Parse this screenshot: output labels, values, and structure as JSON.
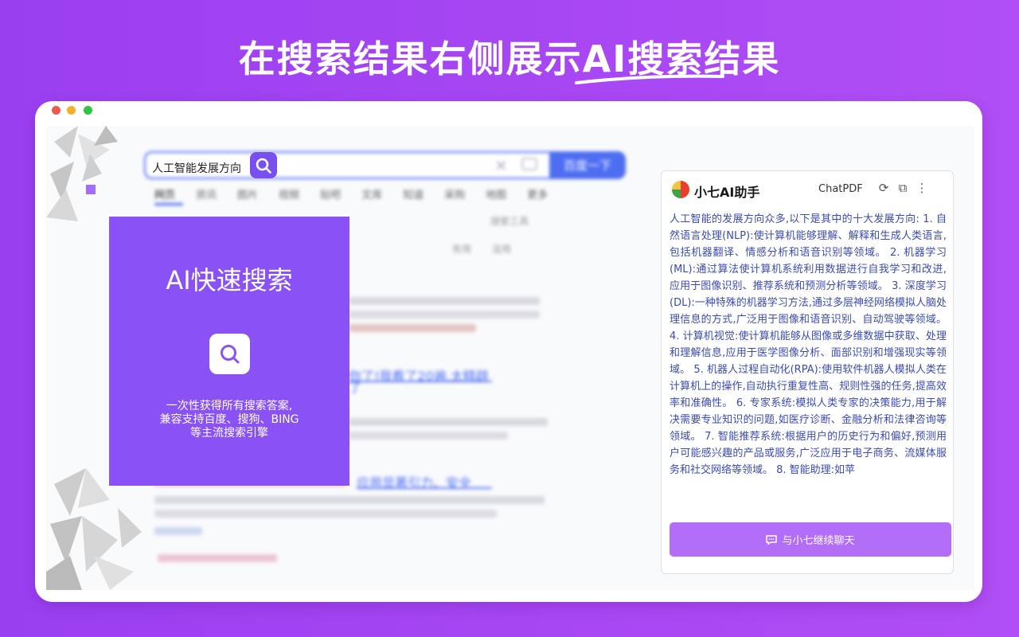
{
  "headline": "在搜索结果右侧展示AI搜索结果",
  "search": {
    "query": "人工智能发展方向",
    "button_label": "百度一下",
    "tabs": [
      "网页",
      "资讯",
      "图片",
      "视频",
      "贴吧",
      "文库",
      "知道",
      "采购",
      "地图",
      "更多"
    ],
    "filter_tool": "搜索工具",
    "feedback": [
      "有用",
      "没用"
    ],
    "result_link_1": "你了!我看了20遍,太精辟了",
    "result_link_2": "应用显著引力、安全"
  },
  "promo": {
    "title": "AI快速搜索",
    "desc_line1": "一次性获得所有搜索答案,",
    "desc_line2": "兼容支持百度、搜狗、BING",
    "desc_line3": "等主流搜索引擎"
  },
  "panel": {
    "title": "小七AI助手",
    "chatpdf": "ChatPDF",
    "body": "人工智能的发展方向众多,以下是其中的十大发展方向: 1. 自然语言处理(NLP):使计算机能够理解、解释和生成人类语言,包括机器翻译、情感分析和语音识别等领域。 2. 机器学习(ML):通过算法使计算机系统利用数据进行自我学习和改进,应用于图像识别、推荐系统和预测分析等领域。 3. 深度学习(DL):一种特殊的机器学习方法,通过多层神经网络模拟人脑处理信息的方式,广泛用于图像和语音识别、自动驾驶等领域。 4. 计算机视觉:使计算机能够从图像或多维数据中获取、处理和理解信息,应用于医学图像分析、面部识别和增强现实等领域。 5. 机器人过程自动化(RPA):使用软件机器人模拟人类在计算机上的操作,自动执行重复性高、规则性强的任务,提高效率和准确性。 6. 专家系统:模拟人类专家的决策能力,用于解决需要专业知识的问题,如医疗诊断、金融分析和法律咨询等领域。 7. 智能推荐系统:根据用户的历史行为和偏好,预测用户可能感兴趣的产品或服务,广泛应用于电子商务、流媒体服务和社交网络等领域。 8. 智能助理:如苹",
    "continue_label": "与小七继续聊天"
  },
  "colors": {
    "background": "#a646f3",
    "promo": "#8a52f5",
    "accent_blue": "#4e6ef2",
    "button_purple": "#b36ef7",
    "body_text": "#3b4bb0"
  },
  "icons": [
    "search-icon",
    "clear-icon",
    "camera-icon",
    "refresh-icon",
    "copy-icon",
    "more-icon",
    "chat-bubble-icon",
    "logo-icon"
  ]
}
